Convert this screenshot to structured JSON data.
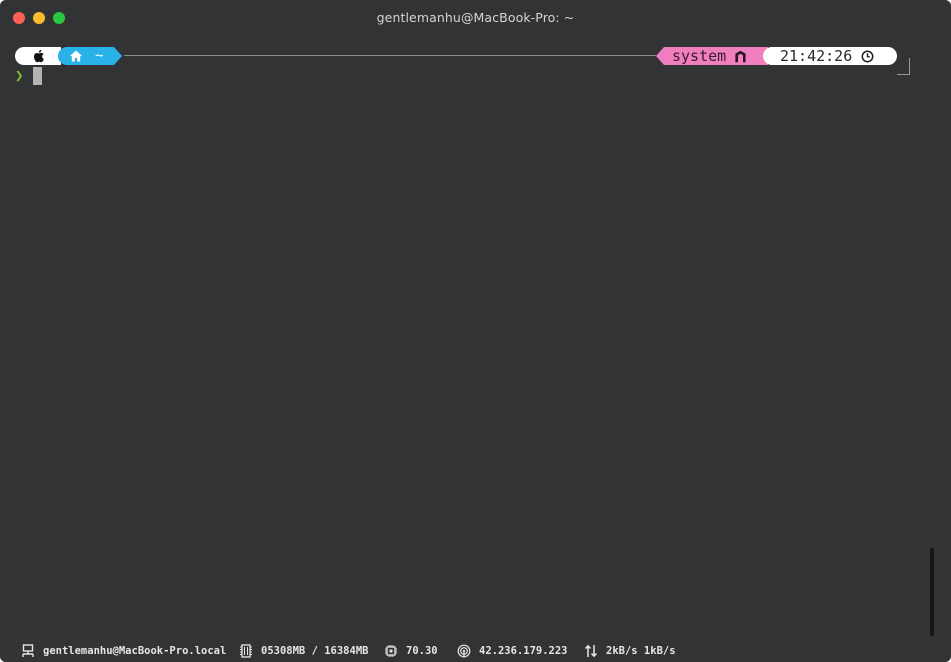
{
  "window": {
    "title": "gentlemanhu@MacBook-Pro: ~"
  },
  "prompt": {
    "os_icon": "apple-icon",
    "home_icon": "home-icon",
    "path": "~",
    "context": "system",
    "context_icon": "node-icon",
    "time": "21:42:26",
    "time_icon": "clock-icon",
    "prompt_char": "❯"
  },
  "statusbar": {
    "host_icon": "network-icon",
    "host": "gentlemanhu@MacBook-Pro.local",
    "memory_icon": "memory-icon",
    "memory": "05308MB / 16384MB",
    "cpu_icon": "cpu-icon",
    "cpu": "70.30",
    "ip_icon": "wifi-icon",
    "ip": "42.236.179.223",
    "traffic_icon": "updown-arrows-icon",
    "traffic": "2kB/s 1kB/s"
  },
  "colors": {
    "terminal_bg": "#323335",
    "home_segment": "#29b2ea",
    "context_segment": "#f07fbf",
    "prompt_char": "#7ec634"
  }
}
